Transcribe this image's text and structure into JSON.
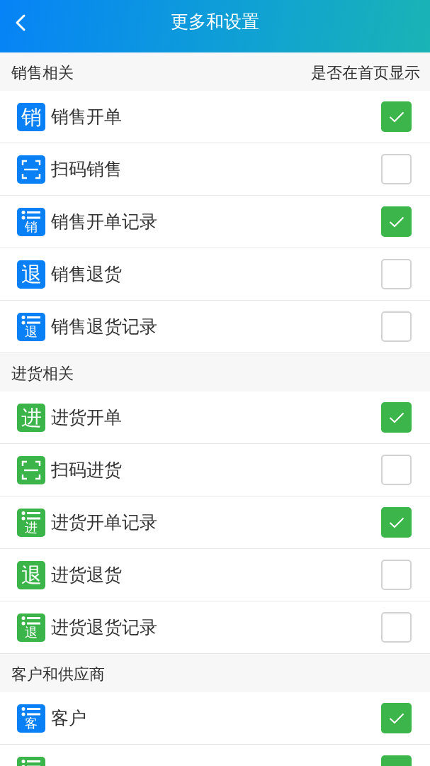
{
  "header": {
    "title": "更多和设置"
  },
  "sections": [
    {
      "title": "销售相关",
      "column_label": "是否在首页显示",
      "items": [
        {
          "label": "销售开单",
          "color": "#0a80f6",
          "icon": {
            "kind": "char",
            "text": "销"
          },
          "checked": true
        },
        {
          "label": "扫码销售",
          "color": "#0a80f6",
          "icon": {
            "kind": "scan"
          },
          "checked": false
        },
        {
          "label": "销售开单记录",
          "color": "#0a80f6",
          "icon": {
            "kind": "list",
            "text": "销"
          },
          "checked": true
        },
        {
          "label": "销售退货",
          "color": "#0a80f6",
          "icon": {
            "kind": "char",
            "text": "退"
          },
          "checked": false
        },
        {
          "label": "销售退货记录",
          "color": "#0a80f6",
          "icon": {
            "kind": "list",
            "text": "退"
          },
          "checked": false
        }
      ]
    },
    {
      "title": "进货相关",
      "items": [
        {
          "label": "进货开单",
          "color": "#3bb44a",
          "icon": {
            "kind": "char",
            "text": "进"
          },
          "checked": true
        },
        {
          "label": "扫码进货",
          "color": "#3bb44a",
          "icon": {
            "kind": "scan"
          },
          "checked": false
        },
        {
          "label": "进货开单记录",
          "color": "#3bb44a",
          "icon": {
            "kind": "list",
            "text": "进"
          },
          "checked": true
        },
        {
          "label": "进货退货",
          "color": "#3bb44a",
          "icon": {
            "kind": "char",
            "text": "退"
          },
          "checked": false
        },
        {
          "label": "进货退货记录",
          "color": "#3bb44a",
          "icon": {
            "kind": "list",
            "text": "退"
          },
          "checked": false
        }
      ]
    },
    {
      "title": "客户和供应商",
      "items": [
        {
          "label": "客户",
          "color": "#0a80f6",
          "icon": {
            "kind": "list",
            "text": "客"
          },
          "checked": true
        },
        {
          "color": "#3bb44a",
          "icon": {
            "kind": "list"
          },
          "checked": true
        }
      ]
    }
  ]
}
